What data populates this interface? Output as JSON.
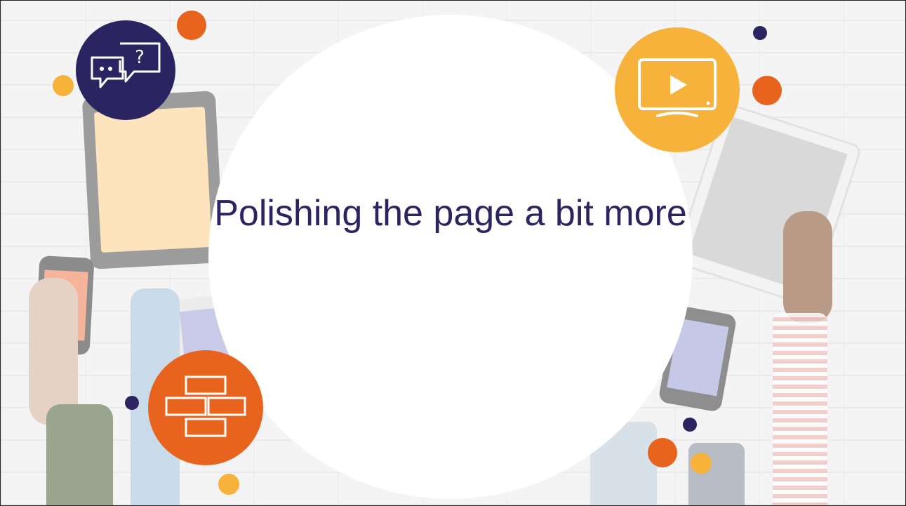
{
  "slide": {
    "title": "Polishing the page a bit more"
  },
  "icons": {
    "chat": "chat-question-icon",
    "video": "tv-play-icon",
    "bricks": "bricks-icon"
  },
  "colors": {
    "navy": "#2a2560",
    "orange": "#e8641e",
    "yellow": "#f6b23a",
    "text": "#2a2560"
  }
}
